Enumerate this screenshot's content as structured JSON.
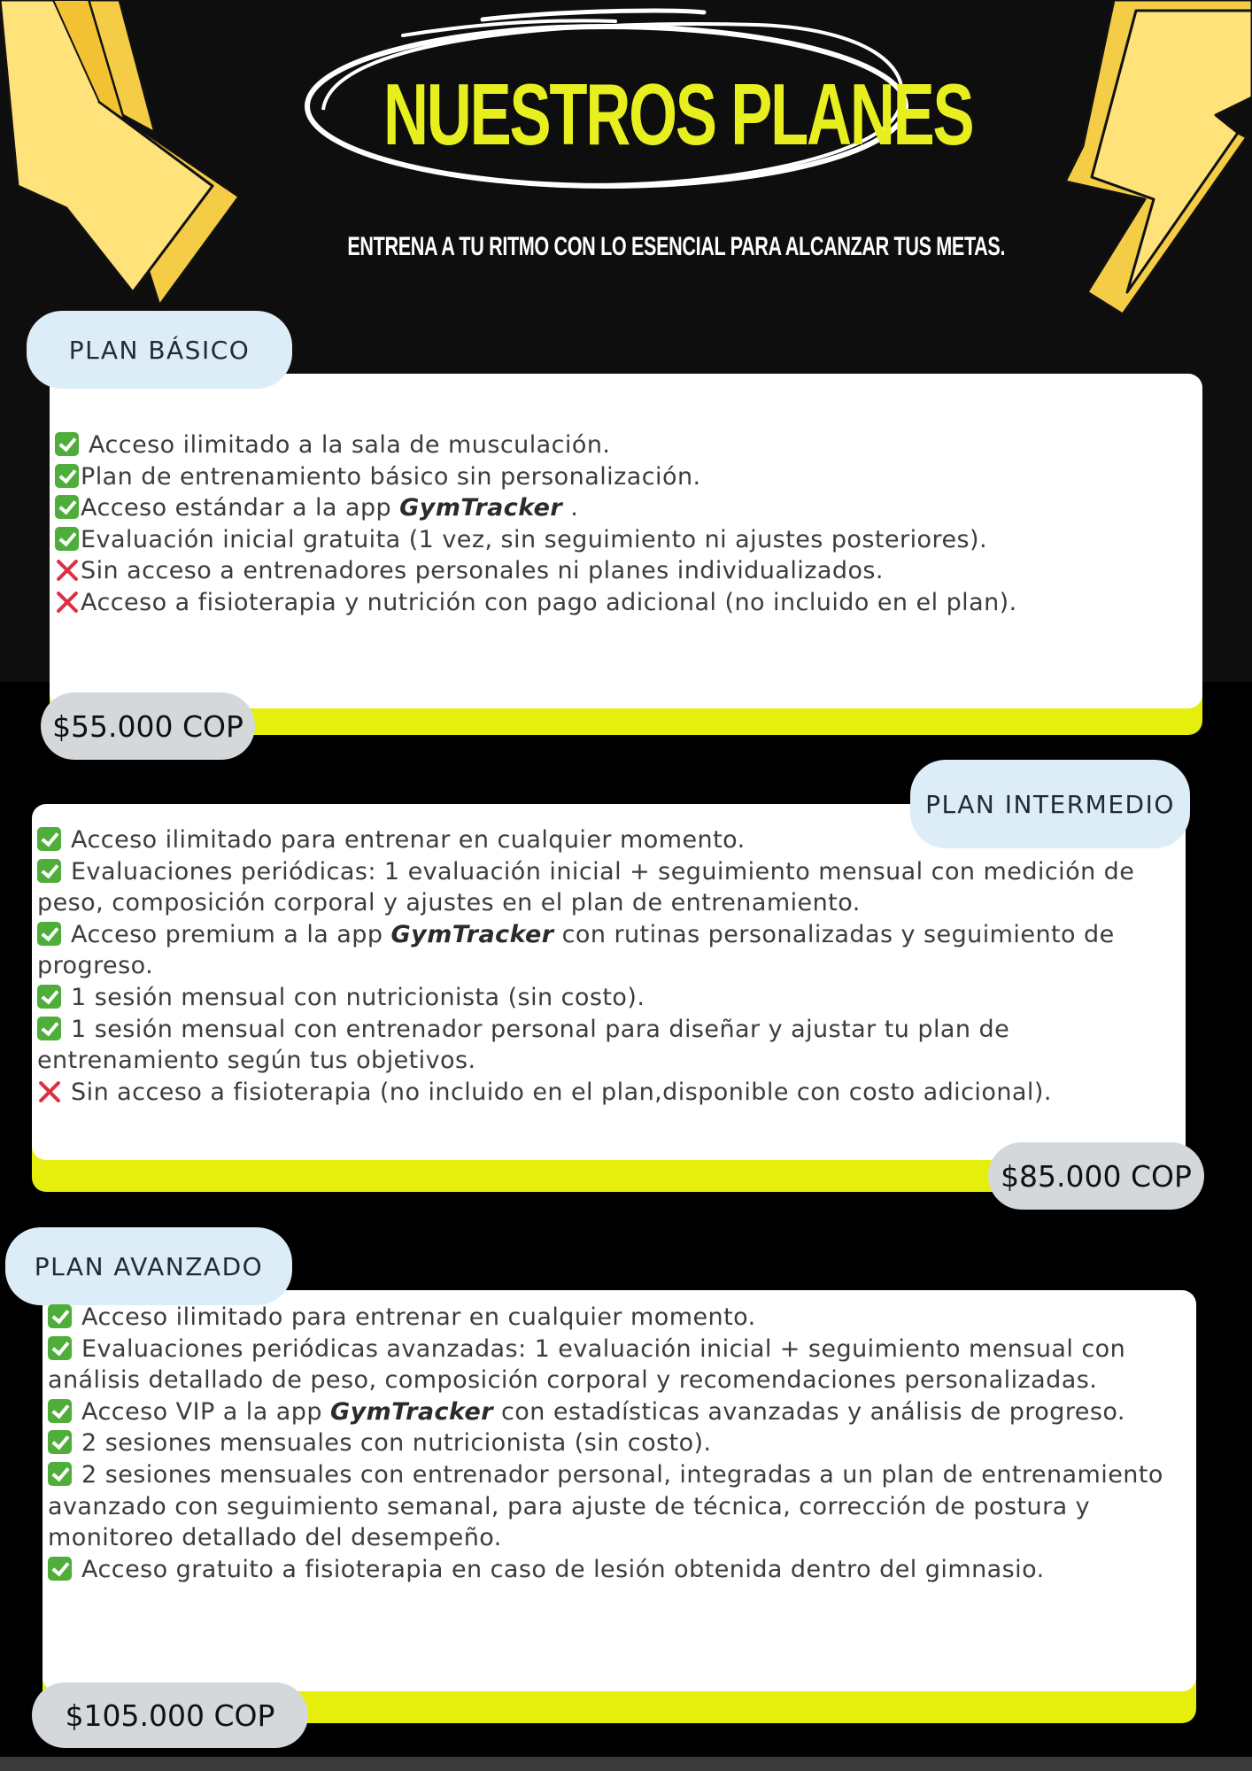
{
  "header": {
    "title": "NUESTROS PLANES",
    "subtitle": "ENTRENA A TU RITMO CON LO ESENCIAL PARA ALCANZAR TUS METAS."
  },
  "colors": {
    "accent_yellow": "#e6ee0e",
    "pill_blue": "#dcedf8",
    "pill_gray": "#d5d8db",
    "check_green": "#4fad3a",
    "cross_red": "#dd2e44"
  },
  "icons": {
    "decoration": "lightning-bolt-icon",
    "included": "check-mark-icon",
    "excluded": "cross-mark-icon"
  },
  "plans": [
    {
      "name": "PLAN BÁSICO",
      "price": "$55.000 COP",
      "features": [
        {
          "icon": "check",
          "text": " Acceso ilimitado a la sala de musculación."
        },
        {
          "icon": "check",
          "text": "Plan de entrenamiento básico sin personalización."
        },
        {
          "icon": "check",
          "before": "Acceso estándar a la app ",
          "app": "GymTracker",
          "after": " ."
        },
        {
          "icon": "check",
          "text": "Evaluación inicial gratuita (1 vez, sin seguimiento ni ajustes posteriores)."
        },
        {
          "icon": "cross",
          "text": "Sin acceso a entrenadores personales ni planes individualizados."
        },
        {
          "icon": "cross",
          "text": "Acceso a fisioterapia y nutrición con pago adicional (no incluido en el plan)."
        }
      ]
    },
    {
      "name": "PLAN INTERMEDIO",
      "price": "$85.000 COP",
      "features": [
        {
          "icon": "check",
          "text": " Acceso ilimitado para entrenar en cualquier momento."
        },
        {
          "icon": "check",
          "text": " Evaluaciones periódicas: 1 evaluación inicial + seguimiento mensual con medición de peso, composición corporal y ajustes en el plan de entrenamiento."
        },
        {
          "icon": "check",
          "before": " Acceso premium a la app ",
          "app": "GymTracker",
          "after": " con rutinas personalizadas y seguimiento de progreso."
        },
        {
          "icon": "check",
          "text": " 1 sesión mensual con nutricionista (sin costo)."
        },
        {
          "icon": "check",
          "text": " 1 sesión mensual con entrenador personal para diseñar y ajustar tu plan de entrenamiento según tus objetivos."
        },
        {
          "icon": "cross",
          "text": " Sin acceso a fisioterapia (no incluido en el plan,disponible con costo adicional)."
        }
      ]
    },
    {
      "name": "PLAN AVANZADO",
      "price": "$105.000 COP",
      "features": [
        {
          "icon": "check",
          "text": " Acceso ilimitado para entrenar en cualquier momento."
        },
        {
          "icon": "check",
          "text": " Evaluaciones periódicas avanzadas: 1 evaluación inicial + seguimiento mensual con análisis detallado de peso, composición corporal y recomendaciones personalizadas."
        },
        {
          "icon": "check",
          "before": " Acceso VIP a la app ",
          "app": "GymTracker",
          "after": " con estadísticas avanzadas y análisis de progreso."
        },
        {
          "icon": "check",
          "text": " 2 sesiones mensuales con nutricionista (sin costo)."
        },
        {
          "icon": "check",
          "text": " 2 sesiones mensuales con entrenador personal, integradas a un plan de entrenamiento avanzado con seguimiento semanal, para ajuste de técnica, corrección de postura y monitoreo detallado del desempeño."
        },
        {
          "icon": "check",
          "text": " Acceso gratuito a fisioterapia en caso de lesión obtenida dentro del gimnasio."
        }
      ]
    }
  ]
}
